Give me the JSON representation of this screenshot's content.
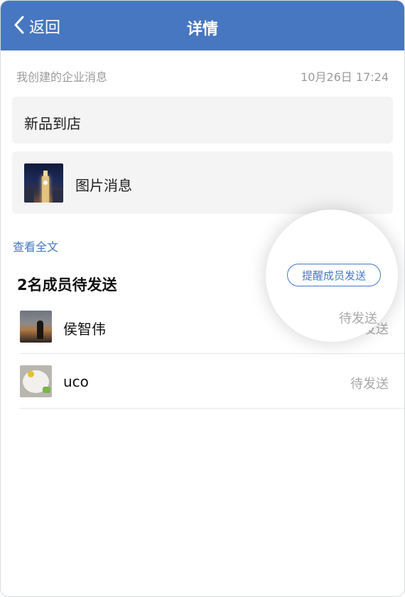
{
  "nav": {
    "back_label": "返回",
    "title": "详情",
    "bg_color": "#4677c0"
  },
  "message": {
    "source_label": "我创建的企业消息",
    "timestamp": "10月26日 17:24",
    "title_text": "新品到店",
    "image_label": "图片消息"
  },
  "actions": {
    "read_all": "查看全文",
    "remind_button": "提醒成员发送"
  },
  "members": {
    "section_title": "2名成员待发送",
    "items": [
      {
        "name": "侯智伟",
        "status": "待发送"
      },
      {
        "name": "uco",
        "status": "待发送"
      }
    ],
    "spotlight_status": "待发送"
  },
  "colors": {
    "accent": "#4677c0",
    "card_bg": "#f4f4f4",
    "muted_text": "#9b9b9b"
  },
  "icons": {
    "back": "chevron-left-icon"
  }
}
